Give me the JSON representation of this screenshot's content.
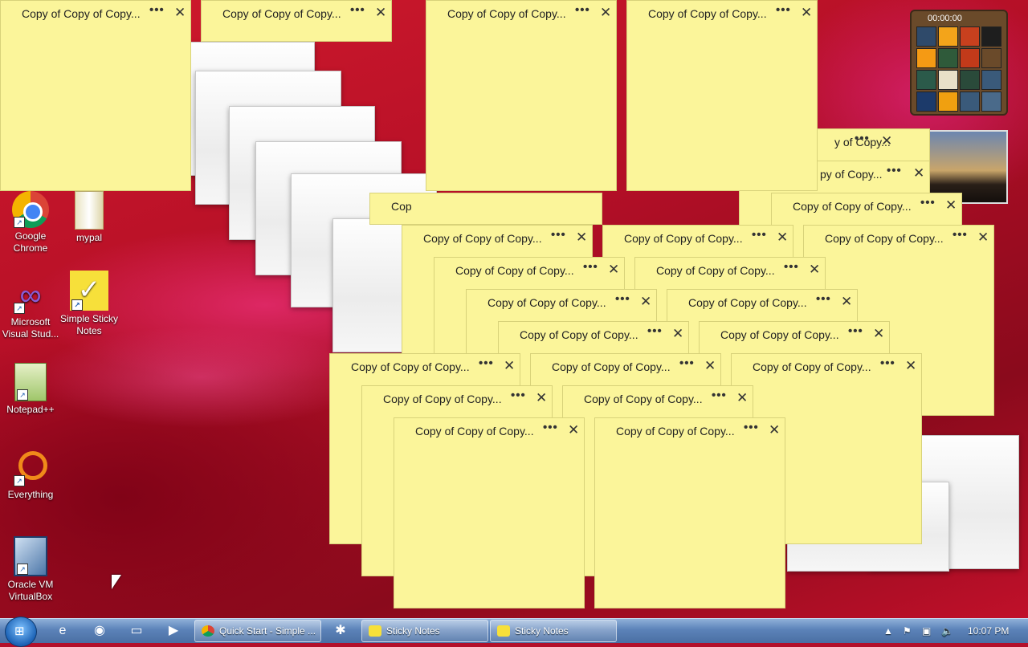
{
  "desktop": {
    "icons": [
      {
        "label": "Google\nChrome",
        "icon": "chrome-icon"
      },
      {
        "label": "mypal",
        "icon": "folder-icon"
      },
      {
        "label": "Microsoft\nVisual Stud...",
        "icon": "visual-studio-icon"
      },
      {
        "label": "Simple Sticky\nNotes",
        "icon": "sticky-notes-icon"
      },
      {
        "label": "Notepad++",
        "icon": "notepadpp-icon"
      },
      {
        "label": "Everything",
        "icon": "everything-icon"
      },
      {
        "label": "Oracle VM\nVirtualBox",
        "icon": "virtualbox-icon"
      }
    ]
  },
  "notes": {
    "title": "Copy of Copy of Copy...",
    "menu_glyph": "•••",
    "close_glyph": "✕",
    "partial_title_1": "Cop",
    "partial_title_2": "y of Copy...",
    "partial_title_3": "py of Copy..."
  },
  "gadget": {
    "timer": "00:00:00"
  },
  "taskbar": {
    "buttons": [
      {
        "label": "Quick Start - Simple ...",
        "icon": "chrome-icon"
      },
      {
        "label": "Sticky Notes",
        "icon": "sticky-notes-icon"
      },
      {
        "label": "Sticky Notes",
        "icon": "sticky-notes-icon"
      }
    ],
    "clock": "10:07 PM"
  },
  "colors": {
    "note_yellow": "#fbf59a",
    "taskbar_blue": "#5b82b8"
  }
}
